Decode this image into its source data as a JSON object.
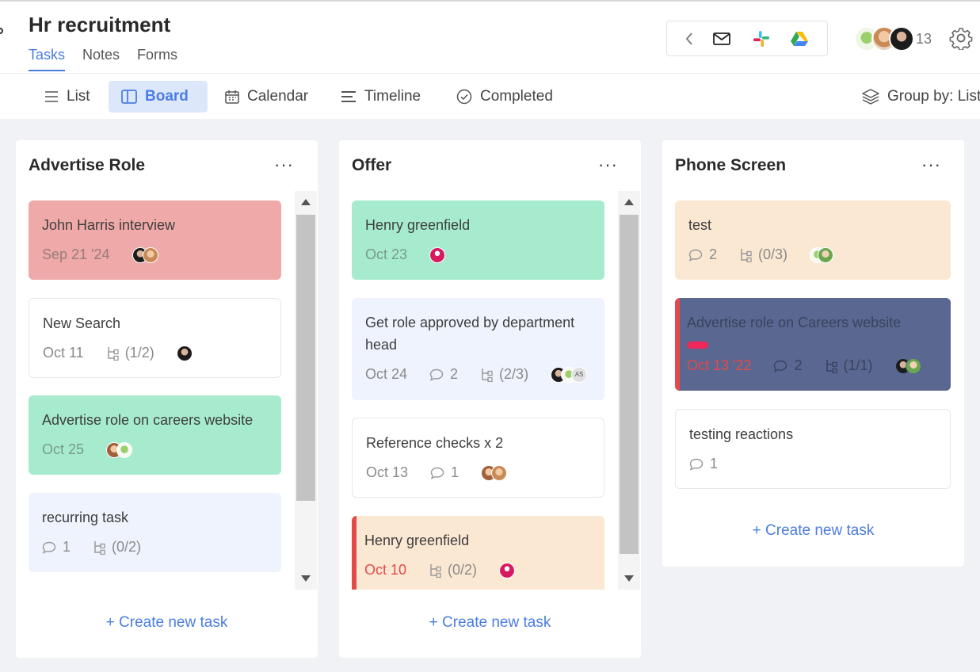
{
  "header": {
    "title": "Hr recruitment",
    "tabs": [
      "Tasks",
      "Notes",
      "Forms"
    ],
    "member_count": "13"
  },
  "integrations": {
    "icons": [
      "chevron-left-icon",
      "gmail-icon",
      "slack-icon",
      "google-drive-icon"
    ]
  },
  "toolbar": {
    "views": [
      "List",
      "Board",
      "Calendar",
      "Timeline",
      "Completed"
    ],
    "active_view": "Board",
    "group_by": "Group by: List"
  },
  "colors": {
    "accent": "#4a7de3",
    "red_card": "#eea9a8",
    "green_card": "#a6ebce",
    "blue_card": "#eef3fd",
    "peach_card": "#fbe8d3",
    "navy_card": "#5a6790",
    "priority_red": "#e44a4a"
  },
  "columns": [
    {
      "title": "Advertise Role",
      "create_label": "+ Create new task",
      "cards": [
        {
          "title": "John Harris interview",
          "date": "Sep 21 '24"
        },
        {
          "title": "New Search",
          "date": "Oct 11",
          "subtasks": "(1/2)"
        },
        {
          "title": "Advertise role on careers website",
          "date": "Oct 25"
        },
        {
          "title": "recurring task",
          "comments": "1",
          "subtasks": "(0/2)"
        }
      ]
    },
    {
      "title": "Offer",
      "create_label": "+ Create new task",
      "cards": [
        {
          "title": "Henry greenfield",
          "date": "Oct 23"
        },
        {
          "title": "Get role approved by department head",
          "date": "Oct 24",
          "comments": "2",
          "subtasks": "(2/3)",
          "avatar_initials": "AS"
        },
        {
          "title": "Reference checks x 2",
          "date": "Oct 13",
          "comments": "1"
        },
        {
          "title": "Henry greenfield",
          "date": "Oct 10",
          "subtasks": "(0/2)"
        }
      ]
    },
    {
      "title": "Phone Screen",
      "create_label": "+ Create new task",
      "cards": [
        {
          "title": "test",
          "comments": "2",
          "subtasks": "(0/3)"
        },
        {
          "title": "Advertise role on Careers website",
          "date": "Oct 13 '22",
          "comments": "2",
          "subtasks": "(1/1)"
        },
        {
          "title": "testing reactions",
          "comments": "1"
        }
      ]
    }
  ]
}
